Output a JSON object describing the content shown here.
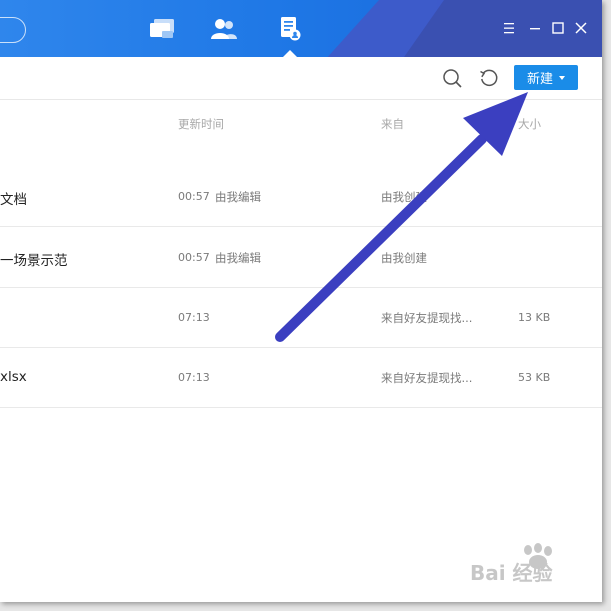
{
  "toolbar": {
    "new_label": "新建",
    "search_icon": "search-icon",
    "refresh_icon": "refresh-icon"
  },
  "nav": {
    "items": [
      {
        "name": "chat",
        "icon": "chat-icon"
      },
      {
        "name": "contacts",
        "icon": "contacts-icon"
      },
      {
        "name": "documents",
        "icon": "document-icon",
        "active": true
      }
    ]
  },
  "window_controls": [
    "menu-icon",
    "minimize-icon",
    "maximize-icon",
    "close-icon"
  ],
  "table": {
    "headers": {
      "time": "更新时间",
      "source": "来自",
      "size": "大小"
    },
    "rows": [
      {
        "name": "文档",
        "time": "00:57",
        "editor": "由我编辑",
        "source": "由我创建",
        "size": ""
      },
      {
        "name": "一场景示范",
        "time": "00:57",
        "editor": "由我编辑",
        "source": "由我创建",
        "size": ""
      },
      {
        "name": "",
        "time": "07:13",
        "editor": "",
        "source": "来自好友提现找...",
        "size": "13 KB"
      },
      {
        "name": "xlsx",
        "time": "07:13",
        "editor": "",
        "source": "来自好友提现找...",
        "size": "53 KB"
      }
    ]
  },
  "watermark": {
    "text": "Bai 经验"
  },
  "colors": {
    "titlebar": "#1f78e6",
    "accent_button": "#1a8ce8",
    "arrow": "#3b3fc0"
  }
}
